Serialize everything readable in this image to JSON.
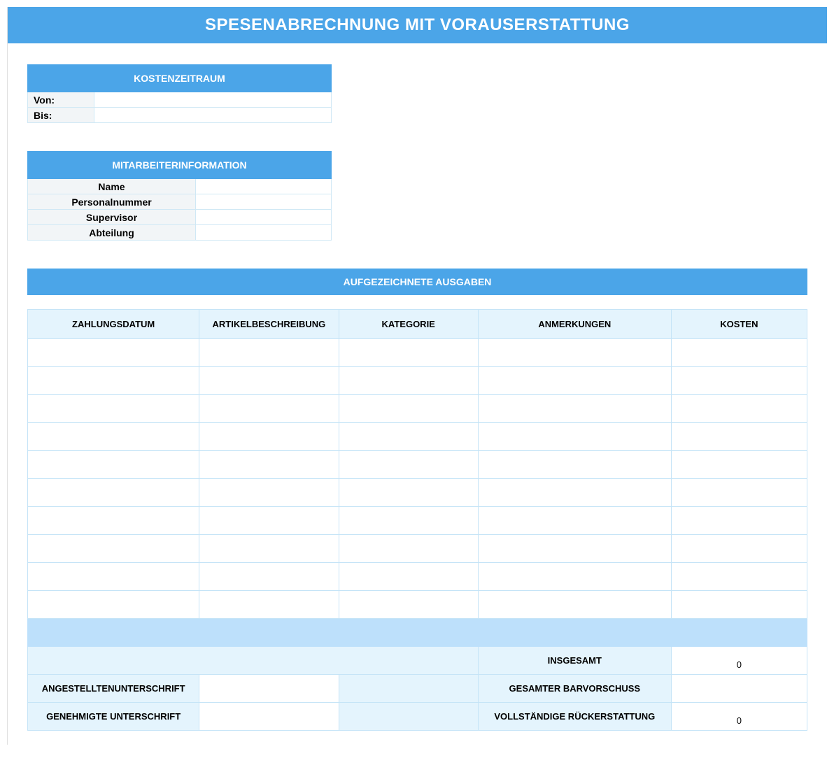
{
  "title": "SPESENABRECHNUNG MIT VORAUSERSTATTUNG",
  "period": {
    "header": "KOSTENZEITRAUM",
    "from_label": "Von:",
    "to_label": "Bis:",
    "from_value": "",
    "to_value": ""
  },
  "employee": {
    "header": "MITARBEITERINFORMATION",
    "name_label": "Name",
    "number_label": "Personalnummer",
    "supervisor_label": "Supervisor",
    "department_label": "Abteilung",
    "name_value": "",
    "number_value": "",
    "supervisor_value": "",
    "department_value": ""
  },
  "expenses": {
    "header": "AUFGEZEICHNETE AUSGABEN",
    "columns": {
      "date": "ZAHLUNGSDATUM",
      "description": "ARTIKELBESCHREIBUNG",
      "category": "KATEGORIE",
      "notes": "ANMERKUNGEN",
      "cost": "KOSTEN"
    }
  },
  "summary": {
    "total_label": "INSGESAMT",
    "total_value": "0",
    "employee_sig_label": "ANGESTELLTENUNTERSCHRIFT",
    "advance_label": "GESAMTER BARVORSCHUSS",
    "advance_value": "",
    "approved_sig_label": "GENEHMIGTE UNTERSCHRIFT",
    "reimbursement_label": "VOLLSTÄNDIGE RÜCKERSTATTUNG",
    "reimbursement_value": "0"
  }
}
